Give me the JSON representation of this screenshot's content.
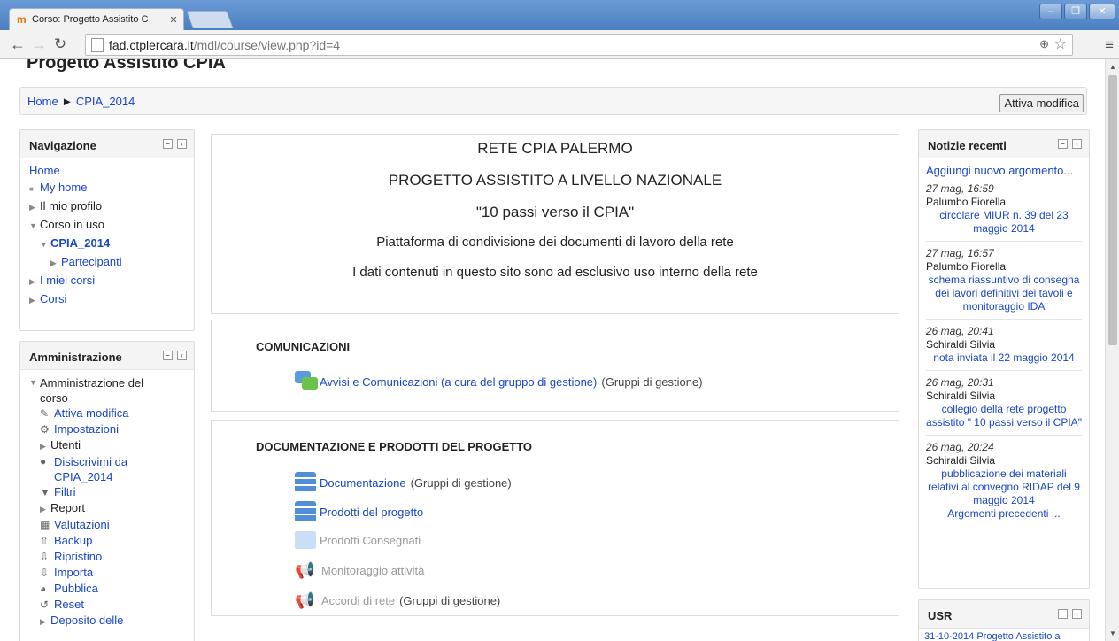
{
  "browser": {
    "tab_title": "Corso: Progetto Assistito C",
    "url_host": "fad.ctplercara.it",
    "url_path": "/mdl/course/view.php?id=4"
  },
  "page": {
    "heading": "Progetto Assistito CPIA",
    "breadcrumb": [
      "Home",
      "CPIA_2014"
    ],
    "breadcrumb_separator": "►",
    "edit_button": "Attiva modifica"
  },
  "navigation": {
    "title": "Navigazione",
    "items": [
      "Home",
      "My home",
      "Il mio profilo",
      "Corso in uso",
      "CPIA_2014",
      "Partecipanti",
      "I miei corsi",
      "Corsi"
    ]
  },
  "admin": {
    "title": "Amministrazione",
    "root": "Amministrazione del corso",
    "items": [
      "Attiva modifica",
      "Impostazioni",
      "Utenti",
      "Disiscrivimi da CPIA_2014",
      "Filtri",
      "Report",
      "Valutazioni",
      "Backup",
      "Ripristino",
      "Importa",
      "Pubblica",
      "Reset",
      "Deposito delle"
    ]
  },
  "summary": {
    "lines": [
      "RETE CPIA PALERMO",
      "PROGETTO ASSISTITO A LIVELLO NAZIONALE",
      "\"10 passi verso il CPIA\"",
      "Piattaforma di condivisione dei documenti di lavoro della rete",
      "I dati contenuti in questo sito sono ad esclusivo uso interno della rete"
    ]
  },
  "sections": [
    {
      "name": "COMUNICAZIONI",
      "activities": [
        {
          "label": "Avvisi e Comunicazioni (a cura del gruppo di gestione)",
          "group": "(Gruppi di gestione)",
          "icon": "forum-icon"
        }
      ]
    },
    {
      "name": "DOCUMENTAZIONE E PRODOTTI DEL PROGETTO",
      "activities": [
        {
          "label": "Documentazione",
          "group": "(Gruppi di gestione)",
          "icon": "database-icon"
        },
        {
          "label": "Prodotti del progetto",
          "group": "",
          "icon": "database-icon"
        },
        {
          "label": "Prodotti Consegnati",
          "group": "",
          "icon": "folder-icon"
        },
        {
          "label": "Monitoraggio attività",
          "group": "",
          "icon": "megaphone-icon"
        },
        {
          "label": "Accordi di rete",
          "group": "(Gruppi di gestione)",
          "icon": "megaphone-icon"
        }
      ]
    }
  ],
  "news": {
    "title": "Notizie recenti",
    "add_link": "Aggiungi nuovo argomento...",
    "posts": [
      {
        "date": "27 mag, 16:59",
        "author": "Palumbo Fiorella",
        "subject": "circolare MIUR n. 39 del 23 maggio 2014"
      },
      {
        "date": "27 mag, 16:57",
        "author": "Palumbo Fiorella",
        "subject": "schema riassuntivo di consegna dei lavori definitivi dei tavoli e monitoraggio IDA"
      },
      {
        "date": "26 mag, 20:41",
        "author": "Schiraldi Silvia",
        "subject": "nota inviata il 22 maggio 2014"
      },
      {
        "date": "26 mag, 20:31",
        "author": "Schiraldi Silvia",
        "subject": "collegio della rete progetto assistito \" 10 passi verso il CPIA\""
      },
      {
        "date": "26 mag, 20:24",
        "author": "Schiraldi Silvia",
        "subject": "pubblicazione dei materiali relativi al convegno RIDAP del 9 maggio 2014"
      }
    ],
    "older": "Argomenti precedenti ..."
  },
  "usr": {
    "title": "USR",
    "first_item": "31-10-2014 Progetto Assistito a"
  }
}
